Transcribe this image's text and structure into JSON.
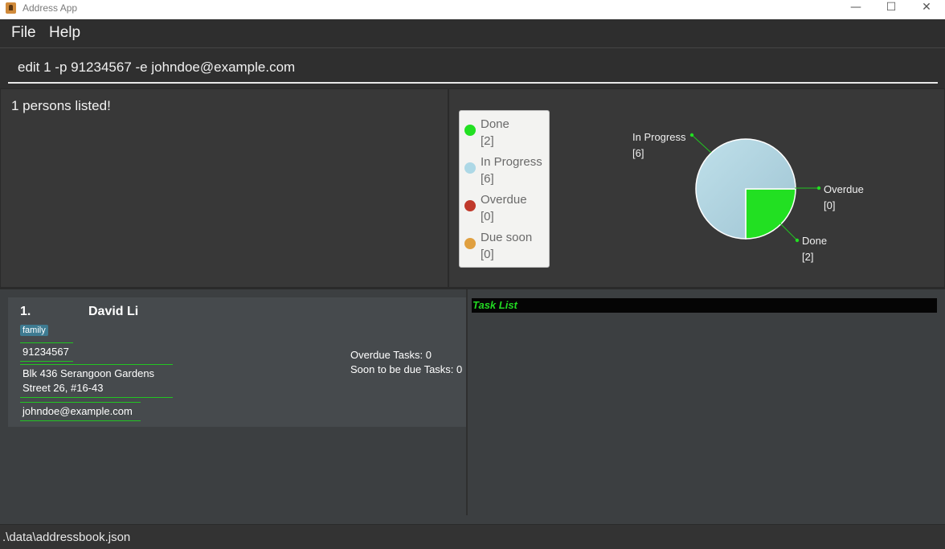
{
  "window": {
    "title": "Address App",
    "minimize": "—",
    "maximize": "☐",
    "close": "✕"
  },
  "menu": {
    "file": "File",
    "help": "Help"
  },
  "command": {
    "value": "edit 1 -p 91234567 -e johndoe@example.com"
  },
  "result": {
    "text": "1 persons listed!"
  },
  "chart_data": {
    "type": "pie",
    "title": "",
    "legend_position": "left",
    "slices": [
      {
        "label": "Done",
        "value": 2,
        "color": "#22e022"
      },
      {
        "label": "In Progress",
        "value": 6,
        "color": "#add8e6"
      },
      {
        "label": "Overdue",
        "value": 0,
        "color": "#c0392b"
      },
      {
        "label": "Due soon",
        "value": 0,
        "color": "#e0a040"
      }
    ],
    "legend": [
      {
        "name": "Done",
        "count": "[2]",
        "color": "#22e022"
      },
      {
        "name": "In Progress",
        "count": "[6]",
        "color": "#add8e6"
      },
      {
        "name": "Overdue",
        "count": "[0]",
        "color": "#c0392b"
      },
      {
        "name": "Due soon",
        "count": "[0]",
        "color": "#e0a040"
      }
    ],
    "callouts": [
      {
        "name": "In Progress",
        "count": "[6]"
      },
      {
        "name": "Overdue",
        "count": "[0]"
      },
      {
        "name": "Done",
        "count": "[2]"
      }
    ]
  },
  "person": {
    "index": "1.",
    "name": "David Li",
    "tag": "family",
    "phone": "91234567",
    "address_line1": "Blk 436 Serangoon Gardens",
    "address_line2": "Street 26, #16-43",
    "email": "johndoe@example.com",
    "overdue": "Overdue Tasks: 0",
    "soon_due": "Soon to be due Tasks: 0"
  },
  "task_list": {
    "header": "Task List"
  },
  "status": {
    "path": ".\\data\\addressbook.json"
  }
}
